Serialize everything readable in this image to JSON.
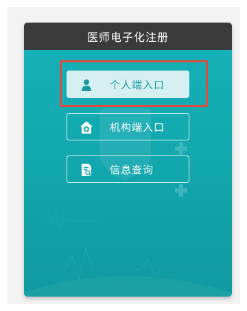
{
  "header": {
    "title": "医师电子化注册"
  },
  "buttons": [
    {
      "label": "个人端入口",
      "icon": "person-icon",
      "state": "active"
    },
    {
      "label": "机构端入口",
      "icon": "medical-house-icon",
      "state": "normal"
    },
    {
      "label": "信息查询",
      "icon": "document-search-icon",
      "state": "normal"
    }
  ],
  "colors": {
    "card_teal": "#16b2b8",
    "header_dark": "#3b3b3b",
    "active_button_bg": "#d6f0f2",
    "active_button_text": "#1c9aa0",
    "highlight_red": "#e04b40"
  }
}
